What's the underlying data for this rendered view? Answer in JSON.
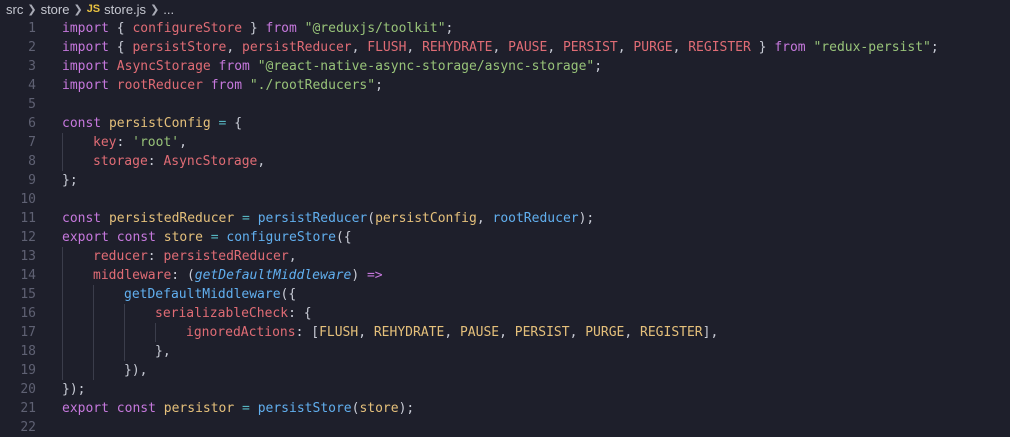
{
  "breadcrumb": {
    "items": [
      "src",
      "store"
    ],
    "file_badge": "JS",
    "file_name": "store.js",
    "tail": "..."
  },
  "editor": {
    "lines": [
      {
        "n": "1",
        "indent": 0,
        "tokens": [
          [
            "kw",
            "import"
          ],
          [
            "pun",
            " { "
          ],
          [
            "var",
            "configureStore"
          ],
          [
            "pun",
            " } "
          ],
          [
            "kw",
            "from"
          ],
          [
            "pun",
            " "
          ],
          [
            "str",
            "\"@reduxjs/toolkit\""
          ],
          [
            "pun",
            ";"
          ]
        ]
      },
      {
        "n": "2",
        "indent": 0,
        "tokens": [
          [
            "kw",
            "import"
          ],
          [
            "pun",
            " { "
          ],
          [
            "var",
            "persistStore"
          ],
          [
            "pun",
            ", "
          ],
          [
            "var",
            "persistReducer"
          ],
          [
            "pun",
            ", "
          ],
          [
            "var",
            "FLUSH"
          ],
          [
            "pun",
            ", "
          ],
          [
            "var",
            "REHYDRATE"
          ],
          [
            "pun",
            ", "
          ],
          [
            "var",
            "PAUSE"
          ],
          [
            "pun",
            ", "
          ],
          [
            "var",
            "PERSIST"
          ],
          [
            "pun",
            ", "
          ],
          [
            "var",
            "PURGE"
          ],
          [
            "pun",
            ", "
          ],
          [
            "var",
            "REGISTER"
          ],
          [
            "pun",
            " } "
          ],
          [
            "kw",
            "from"
          ],
          [
            "pun",
            " "
          ],
          [
            "str",
            "\"redux-persist\""
          ],
          [
            "pun",
            ";"
          ]
        ]
      },
      {
        "n": "3",
        "indent": 0,
        "tokens": [
          [
            "kw",
            "import"
          ],
          [
            "pun",
            " "
          ],
          [
            "var",
            "AsyncStorage"
          ],
          [
            "pun",
            " "
          ],
          [
            "kw",
            "from"
          ],
          [
            "pun",
            " "
          ],
          [
            "str",
            "\"@react-native-async-storage/async-storage\""
          ],
          [
            "pun",
            ";"
          ]
        ]
      },
      {
        "n": "4",
        "indent": 0,
        "tokens": [
          [
            "kw",
            "import"
          ],
          [
            "pun",
            " "
          ],
          [
            "var",
            "rootReducer"
          ],
          [
            "pun",
            " "
          ],
          [
            "kw",
            "from"
          ],
          [
            "pun",
            " "
          ],
          [
            "str",
            "\"./rootReducers\""
          ],
          [
            "pun",
            ";"
          ]
        ]
      },
      {
        "n": "5",
        "indent": 0,
        "tokens": []
      },
      {
        "n": "6",
        "indent": 0,
        "tokens": [
          [
            "kw",
            "const"
          ],
          [
            "pun",
            " "
          ],
          [
            "prop",
            "persistConfig"
          ],
          [
            "pun",
            " "
          ],
          [
            "opr",
            "="
          ],
          [
            "pun",
            " {"
          ]
        ]
      },
      {
        "n": "7",
        "indent": 1,
        "tokens": [
          [
            "var",
            "key"
          ],
          [
            "pun",
            ": "
          ],
          [
            "str",
            "'root'"
          ],
          [
            "pun",
            ","
          ]
        ]
      },
      {
        "n": "8",
        "indent": 1,
        "tokens": [
          [
            "var",
            "storage"
          ],
          [
            "pun",
            ": "
          ],
          [
            "var",
            "AsyncStorage"
          ],
          [
            "pun",
            ","
          ]
        ]
      },
      {
        "n": "9",
        "indent": 0,
        "tokens": [
          [
            "pun",
            "};"
          ]
        ]
      },
      {
        "n": "10",
        "indent": 0,
        "tokens": []
      },
      {
        "n": "11",
        "indent": 0,
        "tokens": [
          [
            "kw",
            "const"
          ],
          [
            "pun",
            " "
          ],
          [
            "prop",
            "persistedReducer"
          ],
          [
            "pun",
            " "
          ],
          [
            "opr",
            "="
          ],
          [
            "pun",
            " "
          ],
          [
            "fn",
            "persistReducer"
          ],
          [
            "par",
            "("
          ],
          [
            "prop",
            "persistConfig"
          ],
          [
            "pun",
            ", "
          ],
          [
            "fn",
            "rootReducer"
          ],
          [
            "par",
            ")"
          ],
          [
            "pun",
            ";"
          ]
        ]
      },
      {
        "n": "12",
        "indent": 0,
        "tokens": [
          [
            "kw",
            "export"
          ],
          [
            "pun",
            " "
          ],
          [
            "kw",
            "const"
          ],
          [
            "pun",
            " "
          ],
          [
            "prop",
            "store"
          ],
          [
            "pun",
            " "
          ],
          [
            "opr",
            "="
          ],
          [
            "pun",
            " "
          ],
          [
            "fn",
            "configureStore"
          ],
          [
            "par",
            "({"
          ]
        ]
      },
      {
        "n": "13",
        "indent": 1,
        "tokens": [
          [
            "var",
            "reducer"
          ],
          [
            "pun",
            ": "
          ],
          [
            "var",
            "persistedReducer"
          ],
          [
            "pun",
            ","
          ]
        ]
      },
      {
        "n": "14",
        "indent": 1,
        "tokens": [
          [
            "var",
            "middleware"
          ],
          [
            "pun",
            ": "
          ],
          [
            "par",
            "("
          ],
          [
            "param",
            "getDefaultMiddleware"
          ],
          [
            "par",
            ")"
          ],
          [
            "pun",
            " "
          ],
          [
            "kw",
            "=>"
          ]
        ]
      },
      {
        "n": "15",
        "indent": 2,
        "tokens": [
          [
            "fn",
            "getDefaultMiddleware"
          ],
          [
            "par",
            "({"
          ]
        ]
      },
      {
        "n": "16",
        "indent": 3,
        "tokens": [
          [
            "var",
            "serializableCheck"
          ],
          [
            "pun",
            ": {"
          ]
        ]
      },
      {
        "n": "17",
        "indent": 4,
        "tokens": [
          [
            "var",
            "ignoredActions"
          ],
          [
            "pun",
            ": "
          ],
          [
            "par",
            "["
          ],
          [
            "prop",
            "FLUSH"
          ],
          [
            "pun",
            ", "
          ],
          [
            "prop",
            "REHYDRATE"
          ],
          [
            "pun",
            ", "
          ],
          [
            "prop",
            "PAUSE"
          ],
          [
            "pun",
            ", "
          ],
          [
            "prop",
            "PERSIST"
          ],
          [
            "pun",
            ", "
          ],
          [
            "prop",
            "PURGE"
          ],
          [
            "pun",
            ", "
          ],
          [
            "prop",
            "REGISTER"
          ],
          [
            "par",
            "]"
          ],
          [
            "pun",
            ","
          ]
        ]
      },
      {
        "n": "18",
        "indent": 3,
        "tokens": [
          [
            "pun",
            "},"
          ]
        ]
      },
      {
        "n": "19",
        "indent": 2,
        "tokens": [
          [
            "par",
            "})"
          ],
          [
            "pun",
            ","
          ]
        ]
      },
      {
        "n": "20",
        "indent": 0,
        "tokens": [
          [
            "par",
            "})"
          ],
          [
            "pun",
            ";"
          ]
        ]
      },
      {
        "n": "21",
        "indent": 0,
        "tokens": [
          [
            "kw",
            "export"
          ],
          [
            "pun",
            " "
          ],
          [
            "kw",
            "const"
          ],
          [
            "pun",
            " "
          ],
          [
            "prop",
            "persistor"
          ],
          [
            "pun",
            " "
          ],
          [
            "opr",
            "="
          ],
          [
            "pun",
            " "
          ],
          [
            "fn",
            "persistStore"
          ],
          [
            "par",
            "("
          ],
          [
            "prop",
            "store"
          ],
          [
            "par",
            ")"
          ],
          [
            "pun",
            ";"
          ]
        ]
      },
      {
        "n": "22",
        "indent": 0,
        "tokens": []
      }
    ]
  }
}
